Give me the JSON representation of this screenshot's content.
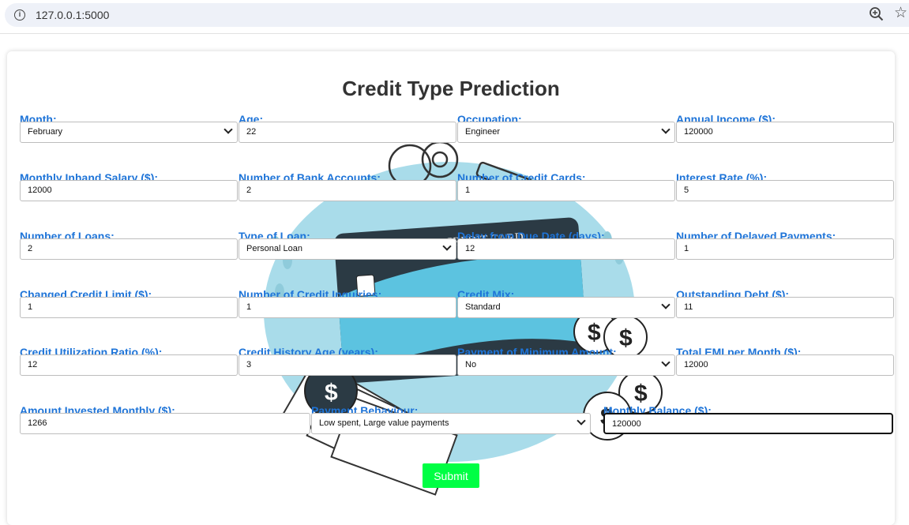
{
  "browser": {
    "url": "127.0.0.1:5000"
  },
  "page": {
    "title": "Credit Type Prediction",
    "submit_label": "Submit",
    "art": {
      "card_text": "CREDIT CARD",
      "coin_symbol": "$"
    }
  },
  "fields": {
    "month": {
      "label": "Month:",
      "value": "February"
    },
    "age": {
      "label": "Age:",
      "value": "22"
    },
    "occupation": {
      "label": "Occupation:",
      "value": "Engineer"
    },
    "annual_income": {
      "label": "Annual Income ($):",
      "value": "120000"
    },
    "monthly_salary": {
      "label": "Monthly Inhand Salary ($):",
      "value": "12000"
    },
    "bank_accounts": {
      "label": "Number of Bank Accounts:",
      "value": "2"
    },
    "credit_cards": {
      "label": "Number of Credit Cards:",
      "value": "1"
    },
    "interest_rate": {
      "label": "Interest Rate (%):",
      "value": "5"
    },
    "num_loans": {
      "label": "Number of Loans:",
      "value": "2"
    },
    "loan_type": {
      "label": "Type of Loan:",
      "value": "Personal Loan"
    },
    "delay_days": {
      "label": "Delay from Due Date (days):",
      "value": "12"
    },
    "delayed_payments": {
      "label": "Number of Delayed Payments:",
      "value": "1"
    },
    "changed_limit": {
      "label": "Changed Credit Limit ($):",
      "value": "1"
    },
    "credit_inquiries": {
      "label": "Number of Credit Inquiries:",
      "value": "1"
    },
    "credit_mix": {
      "label": "Credit Mix:",
      "value": "Standard"
    },
    "outstanding_debt": {
      "label": "Outstanding Debt ($):",
      "value": "11"
    },
    "utilization": {
      "label": "Credit Utilization Ratio (%):",
      "value": "12"
    },
    "history_age": {
      "label": "Credit History Age (years):",
      "value": "3"
    },
    "min_payment": {
      "label": "Payment of Minimum Amount:",
      "value": "No"
    },
    "total_emi": {
      "label": "Total EMI per Month ($):",
      "value": "12000"
    },
    "invested": {
      "label": "Amount Invested Monthly ($):",
      "value": "1266"
    },
    "payment_behaviour": {
      "label": "Payment Behaviour:",
      "value": "Low spent, Large value payments"
    },
    "monthly_balance": {
      "label": "Monthly Balance ($):",
      "value": "120000"
    }
  },
  "colors": {
    "label": "#1e74d8",
    "submit": "#00ff44",
    "art_blue": "#a9dcea",
    "card_dark": "#2b3a44",
    "card_stripe": "#5cc3e0"
  },
  "icons": [
    "info-icon",
    "zoom-icon",
    "star-icon",
    "chevron-down-icon"
  ]
}
